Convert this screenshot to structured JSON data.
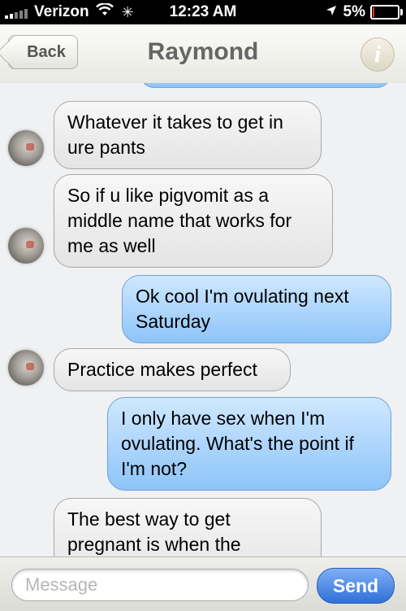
{
  "status_bar": {
    "carrier": "Verizon",
    "time": "12:23 AM",
    "battery": "5%",
    "battery_level": 0.05
  },
  "nav": {
    "back_label": "Back",
    "title": "Raymond",
    "info_label": "i"
  },
  "messages": [
    {
      "direction": "incoming",
      "text": "Whatever it takes to get in ure pants"
    },
    {
      "direction": "incoming",
      "text": "So if u like pigvomit as a middle name that works for me as well"
    },
    {
      "direction": "outgoing",
      "text": "Ok cool I'm ovulating next Saturday"
    },
    {
      "direction": "incoming",
      "text": "Practice makes perfect"
    },
    {
      "direction": "outgoing",
      "text": "I only have sex when I'm ovulating. What's the point if I'm not?"
    },
    {
      "direction": "incoming",
      "text": "The best way to get pregnant is when the"
    }
  ],
  "composer": {
    "placeholder": "Message",
    "value": "",
    "send_label": "Send"
  },
  "colors": {
    "outgoing_bubble": "#a9d3fb",
    "incoming_bubble": "#ececec",
    "send_button": "#3f7de0"
  }
}
